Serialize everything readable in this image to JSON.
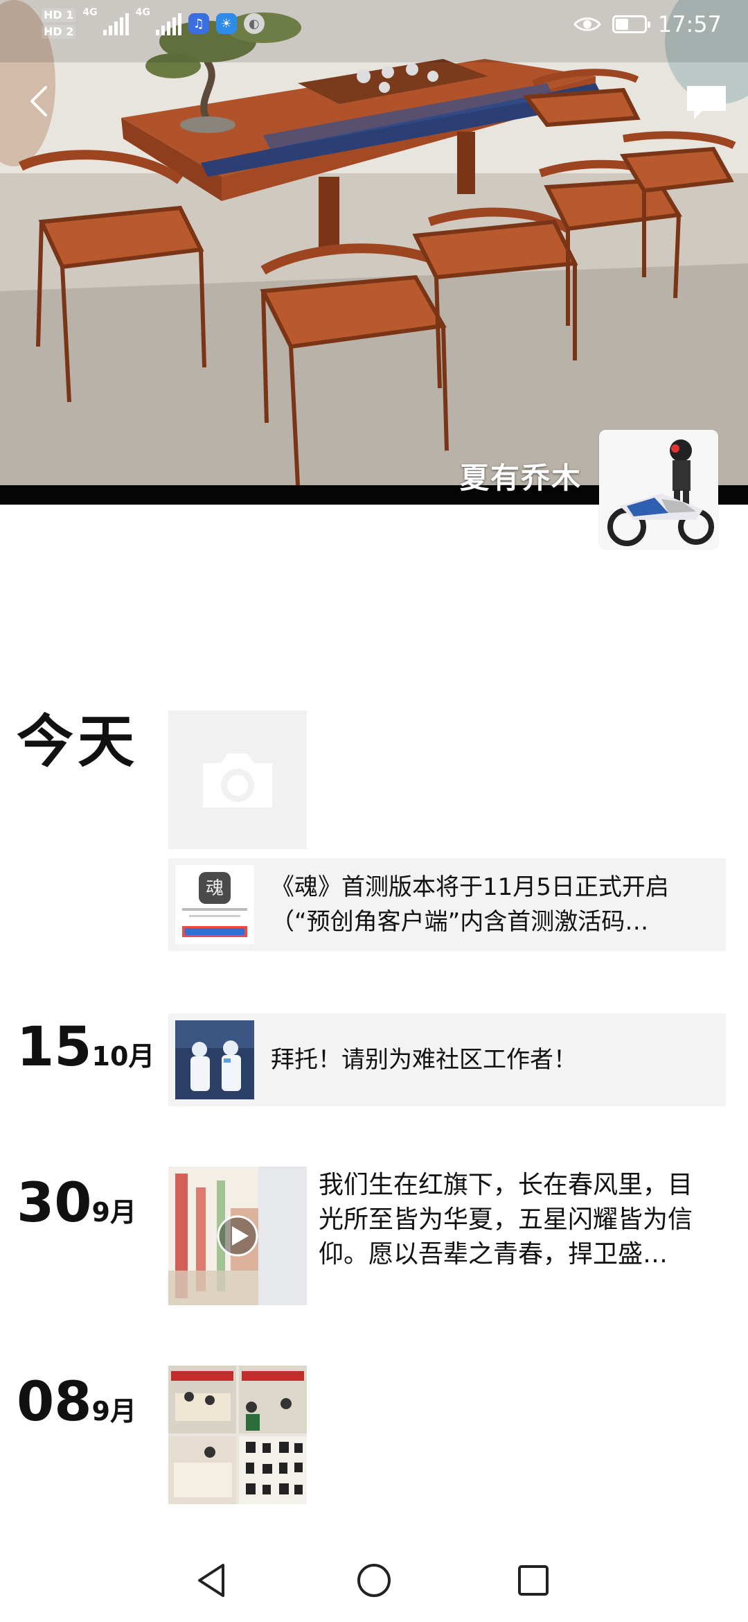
{
  "status_bar": {
    "sim1": "HD 1",
    "sim2": "HD 2",
    "net1": "4G",
    "net2": "4G",
    "time": "17:57",
    "battery_level": 0.45
  },
  "profile": {
    "username": "夏有乔木"
  },
  "timeline": [
    {
      "date_label": "今天",
      "items": [
        {
          "type": "camera"
        },
        {
          "type": "share",
          "text": "《魂》首测版本将于11月5日正式开启（“预创角客户端”内含首测激活码…"
        }
      ]
    },
    {
      "day": "15",
      "month": "10月",
      "items": [
        {
          "type": "share",
          "text": "拜托！请别为难社区工作者！"
        }
      ]
    },
    {
      "day": "30",
      "month": "9月",
      "items": [
        {
          "type": "video",
          "text": "我们生在红旗下，长在春风里，目光所至皆为华夏，五星闪耀皆为信仰。愿以吾辈之青春，捍卫盛…"
        }
      ]
    },
    {
      "day": "08",
      "month": "9月",
      "items": [
        {
          "type": "photo"
        }
      ]
    }
  ],
  "share_line_1": "《魂》首测版本将于11月5日正式开启",
  "share_line_2": "（“预创角客户端”内含首测激活码…",
  "post_line_1": "我们生在红旗下，长在春风里，目",
  "post_line_2": "光所至皆为华夏，五星闪耀皆为信",
  "post_line_3": "仰。愿以吾辈之青春，捍卫盛…",
  "app_card_caption": "魂",
  "colors": {
    "accent_blue": "#2f6fd6",
    "table_wood": "#b0532a",
    "runner_blue": "#2b3f74"
  }
}
